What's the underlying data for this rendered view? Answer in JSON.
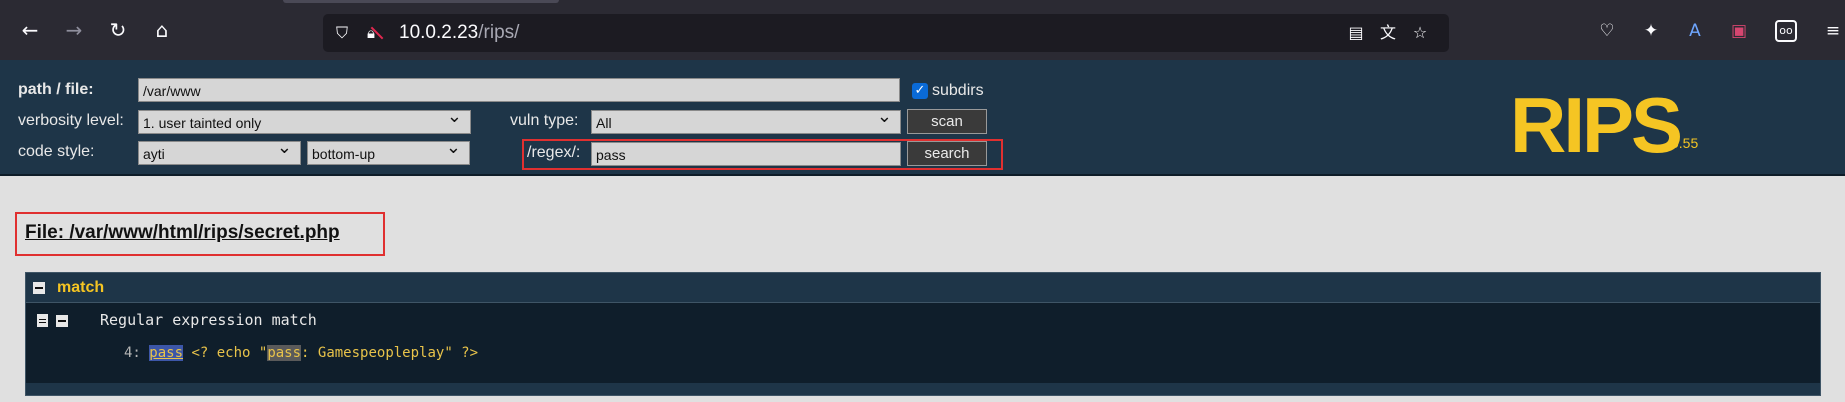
{
  "browser": {
    "url_host": "10.0.2.23",
    "url_path": "/rips/",
    "icons": [
      "back-icon",
      "forward-icon",
      "reload-icon",
      "home-icon",
      "shield-icon",
      "lock-icon",
      "reader-icon",
      "translate-icon",
      "bookmark-star-icon",
      "pocket-icon",
      "extension-icon",
      "translate-extension-icon",
      "extension-icon",
      "extension-icon",
      "menu-icon"
    ]
  },
  "rips": {
    "path_label": "path / file:",
    "path_value": "/var/www",
    "subdirs_label": "subdirs",
    "subdirs_checked": true,
    "verbosity_label": "verbosity level:",
    "verbosity_value": "1. user tainted only",
    "vuln_label": "vuln type:",
    "vuln_value": "All",
    "scan_label": "scan",
    "codestyle_label": "code style:",
    "codestyle_value": "ayti",
    "order_value": "bottom-up",
    "regex_label": "/regex/:",
    "regex_value": "pass",
    "search_label": "search",
    "logo_text": "RIPS",
    "version": "0.55",
    "brand_color": "#f5c523"
  },
  "result": {
    "file_title": "File: /var/www/html/rips/secret.php",
    "section_title": "match",
    "match_type": "Regular expression match",
    "line_no": "4:",
    "code_hl": "pass",
    "code_mid": " <? echo \"",
    "code_hl2": "pass",
    "code_end": ": Gamespeopleplay\" ?>"
  }
}
